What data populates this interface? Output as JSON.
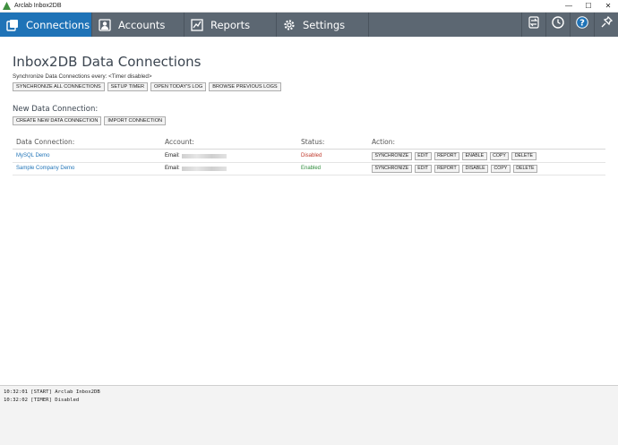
{
  "window": {
    "title": "Arclab Inbox2DB",
    "controls": [
      "—",
      "☐",
      "✕"
    ]
  },
  "nav": {
    "tabs": [
      {
        "label": "Connections",
        "icon": "connections-icon",
        "active": true
      },
      {
        "label": "Accounts",
        "icon": "accounts-icon",
        "active": false
      },
      {
        "label": "Reports",
        "icon": "reports-icon",
        "active": false
      },
      {
        "label": "Settings",
        "icon": "settings-icon",
        "active": false
      }
    ],
    "right_icons": [
      "sync-icon",
      "clock-icon",
      "help-icon",
      "pin-icon"
    ]
  },
  "main": {
    "title": "Inbox2DB Data Connections",
    "sync_text": "Synchronize Data Connections every: <Timer disabled>",
    "sync_buttons": [
      "SYNCHRONIZE ALL CONNECTIONS",
      "SETUP TIMER",
      "OPEN TODAY'S LOG",
      "BROWSE PREVIOUS LOGS"
    ],
    "new_section_title": "New Data Connection:",
    "new_buttons": [
      "CREATE NEW DATA CONNECTION",
      "IMPORT CONNECTION"
    ],
    "table": {
      "headers": [
        "Data Connection:",
        "Account:",
        "Status:",
        "Action:"
      ],
      "rows": [
        {
          "name": "MySQL Demo",
          "account_prefix": "Email:",
          "status": "Disabled",
          "status_color": "#c0392b",
          "actions": [
            "SYNCHRONIZE",
            "EDIT",
            "REPORT",
            "ENABLE",
            "COPY",
            "DELETE"
          ]
        },
        {
          "name": "Sample Company Demo",
          "account_prefix": "Email:",
          "status": "Enabled",
          "status_color": "#2e8b3a",
          "actions": [
            "SYNCHRONIZE",
            "EDIT",
            "REPORT",
            "DISABLE",
            "COPY",
            "DELETE"
          ]
        }
      ]
    }
  },
  "log": {
    "lines": [
      "10:32:01 [START] Arclab Inbox2DB",
      "10:32:02 [TIMER] Disabled"
    ]
  },
  "colors": {
    "nav_bg": "#5c6772",
    "nav_active": "#1f73b7",
    "link": "#1f73b7"
  }
}
